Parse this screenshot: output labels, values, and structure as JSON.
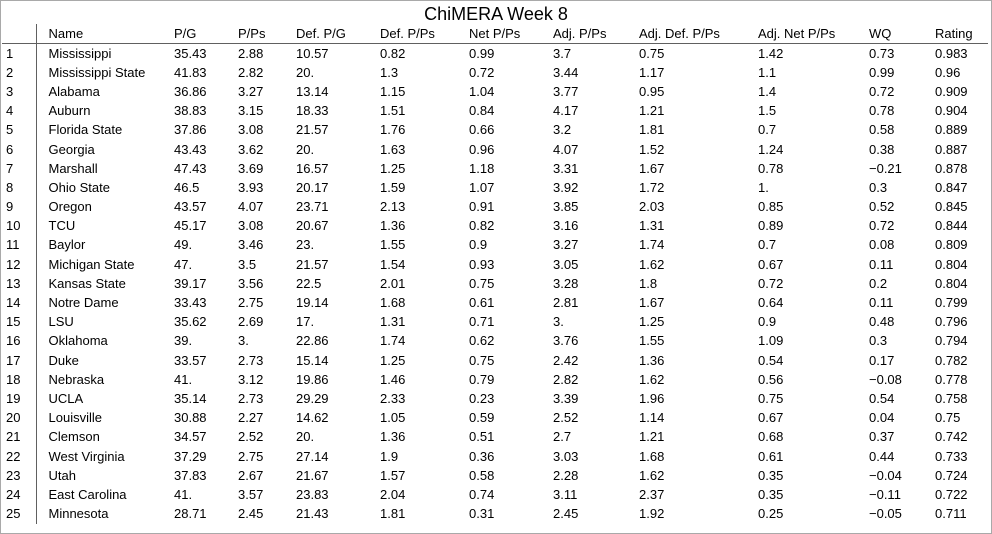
{
  "title": "ChiMERA Week 8",
  "columns": [
    "",
    "Name",
    "P/G",
    "P/Ps",
    "Def. P/G",
    "Def. P/Ps",
    "Net P/Ps",
    "Adj. P/Ps",
    "Adj. Def. P/Ps",
    "Adj. Net P/Ps",
    "WQ",
    "Rating"
  ],
  "rows": [
    [
      "1",
      "Mississippi",
      "35.43",
      "2.88",
      "10.57",
      "0.82",
      "0.99",
      "3.7",
      "0.75",
      "1.42",
      "0.73",
      "0.983"
    ],
    [
      "2",
      "Mississippi State",
      "41.83",
      "2.82",
      "20.",
      "1.3",
      "0.72",
      "3.44",
      "1.17",
      "1.1",
      "0.99",
      "0.96"
    ],
    [
      "3",
      "Alabama",
      "36.86",
      "3.27",
      "13.14",
      "1.15",
      "1.04",
      "3.77",
      "0.95",
      "1.4",
      "0.72",
      "0.909"
    ],
    [
      "4",
      "Auburn",
      "38.83",
      "3.15",
      "18.33",
      "1.51",
      "0.84",
      "4.17",
      "1.21",
      "1.5",
      "0.78",
      "0.904"
    ],
    [
      "5",
      "Florida State",
      "37.86",
      "3.08",
      "21.57",
      "1.76",
      "0.66",
      "3.2",
      "1.81",
      "0.7",
      "0.58",
      "0.889"
    ],
    [
      "6",
      "Georgia",
      "43.43",
      "3.62",
      "20.",
      "1.63",
      "0.96",
      "4.07",
      "1.52",
      "1.24",
      "0.38",
      "0.887"
    ],
    [
      "7",
      "Marshall",
      "47.43",
      "3.69",
      "16.57",
      "1.25",
      "1.18",
      "3.31",
      "1.67",
      "0.78",
      "−0.21",
      "0.878"
    ],
    [
      "8",
      "Ohio State",
      "46.5",
      "3.93",
      "20.17",
      "1.59",
      "1.07",
      "3.92",
      "1.72",
      "1.",
      "0.3",
      "0.847"
    ],
    [
      "9",
      "Oregon",
      "43.57",
      "4.07",
      "23.71",
      "2.13",
      "0.91",
      "3.85",
      "2.03",
      "0.85",
      "0.52",
      "0.845"
    ],
    [
      "10",
      "TCU",
      "45.17",
      "3.08",
      "20.67",
      "1.36",
      "0.82",
      "3.16",
      "1.31",
      "0.89",
      "0.72",
      "0.844"
    ],
    [
      "11",
      "Baylor",
      "49.",
      "3.46",
      "23.",
      "1.55",
      "0.9",
      "3.27",
      "1.74",
      "0.7",
      "0.08",
      "0.809"
    ],
    [
      "12",
      "Michigan State",
      "47.",
      "3.5",
      "21.57",
      "1.54",
      "0.93",
      "3.05",
      "1.62",
      "0.67",
      "0.11",
      "0.804"
    ],
    [
      "13",
      "Kansas State",
      "39.17",
      "3.56",
      "22.5",
      "2.01",
      "0.75",
      "3.28",
      "1.8",
      "0.72",
      "0.2",
      "0.804"
    ],
    [
      "14",
      "Notre Dame",
      "33.43",
      "2.75",
      "19.14",
      "1.68",
      "0.61",
      "2.81",
      "1.67",
      "0.64",
      "0.11",
      "0.799"
    ],
    [
      "15",
      "LSU",
      "35.62",
      "2.69",
      "17.",
      "1.31",
      "0.71",
      "3.",
      "1.25",
      "0.9",
      "0.48",
      "0.796"
    ],
    [
      "16",
      "Oklahoma",
      "39.",
      "3.",
      "22.86",
      "1.74",
      "0.62",
      "3.76",
      "1.55",
      "1.09",
      "0.3",
      "0.794"
    ],
    [
      "17",
      "Duke",
      "33.57",
      "2.73",
      "15.14",
      "1.25",
      "0.75",
      "2.42",
      "1.36",
      "0.54",
      "0.17",
      "0.782"
    ],
    [
      "18",
      "Nebraska",
      "41.",
      "3.12",
      "19.86",
      "1.46",
      "0.79",
      "2.82",
      "1.62",
      "0.56",
      "−0.08",
      "0.778"
    ],
    [
      "19",
      "UCLA",
      "35.14",
      "2.73",
      "29.29",
      "2.33",
      "0.23",
      "3.39",
      "1.96",
      "0.75",
      "0.54",
      "0.758"
    ],
    [
      "20",
      "Louisville",
      "30.88",
      "2.27",
      "14.62",
      "1.05",
      "0.59",
      "2.52",
      "1.14",
      "0.67",
      "0.04",
      "0.75"
    ],
    [
      "21",
      "Clemson",
      "34.57",
      "2.52",
      "20.",
      "1.36",
      "0.51",
      "2.7",
      "1.21",
      "0.68",
      "0.37",
      "0.742"
    ],
    [
      "22",
      "West Virginia",
      "37.29",
      "2.75",
      "27.14",
      "1.9",
      "0.36",
      "3.03",
      "1.68",
      "0.61",
      "0.44",
      "0.733"
    ],
    [
      "23",
      "Utah",
      "37.83",
      "2.67",
      "21.67",
      "1.57",
      "0.58",
      "2.28",
      "1.62",
      "0.35",
      "−0.04",
      "0.724"
    ],
    [
      "24",
      "East Carolina",
      "41.",
      "3.57",
      "23.83",
      "2.04",
      "0.74",
      "3.11",
      "2.37",
      "0.35",
      "−0.11",
      "0.722"
    ],
    [
      "25",
      "Minnesota",
      "28.71",
      "2.45",
      "21.43",
      "1.81",
      "0.31",
      "2.45",
      "1.92",
      "0.25",
      "−0.05",
      "0.711"
    ]
  ]
}
